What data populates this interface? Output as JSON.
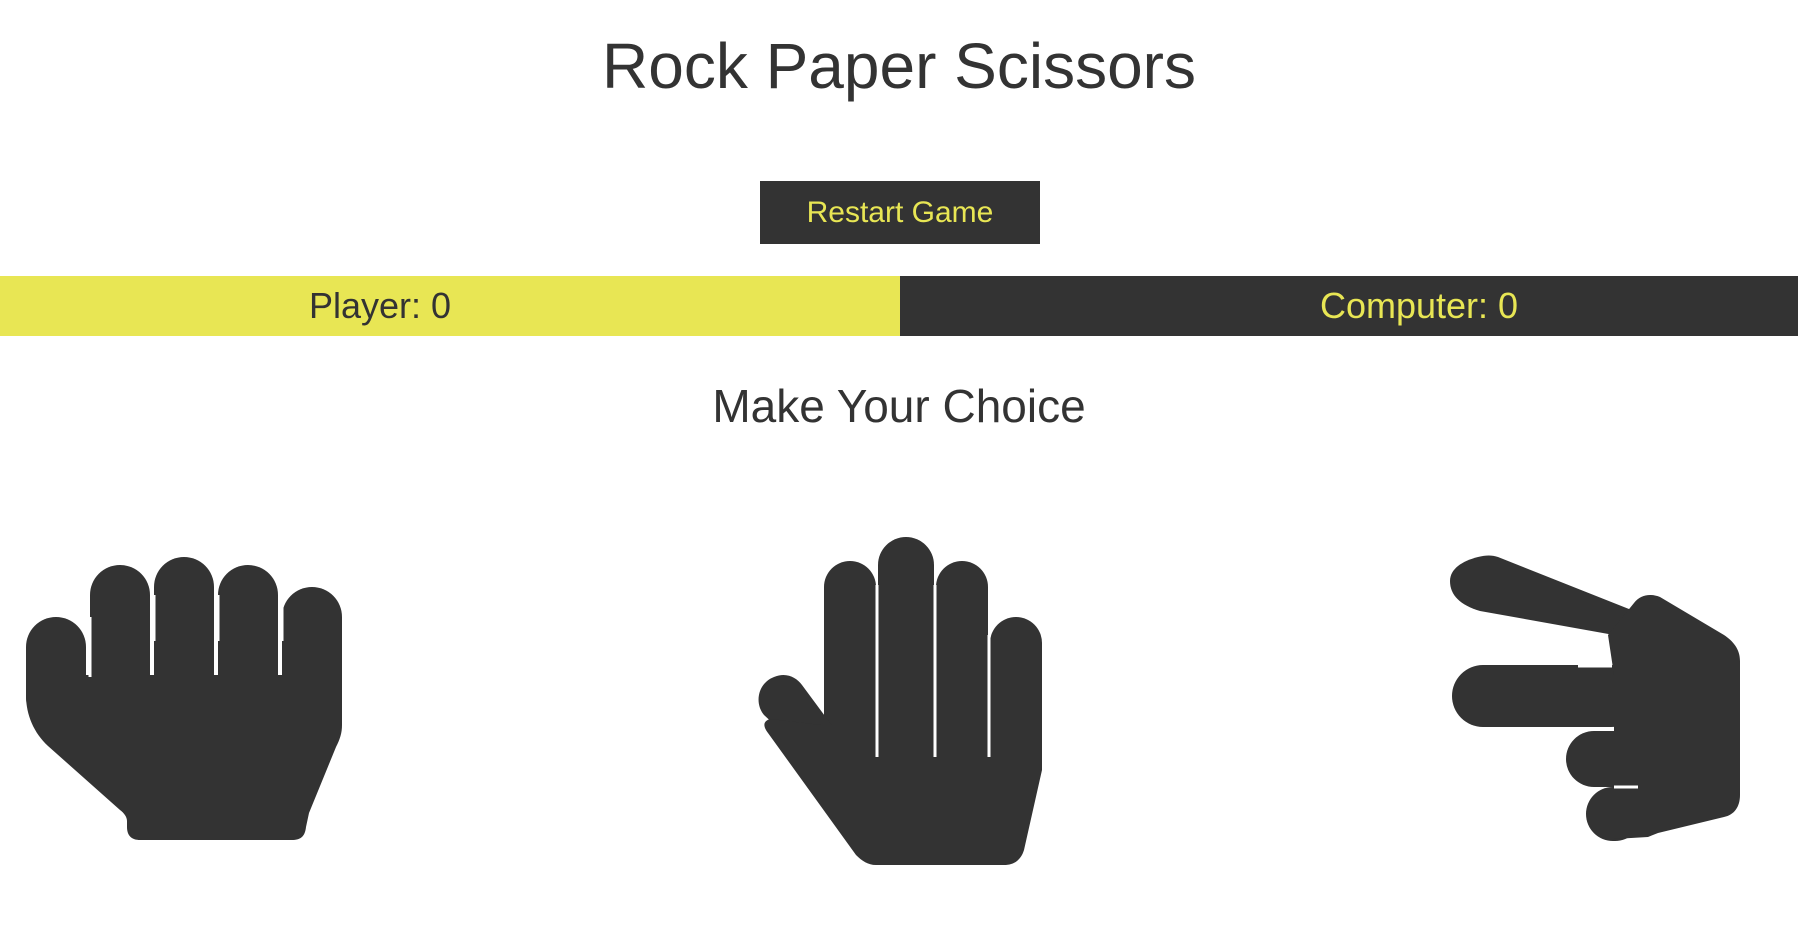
{
  "title": "Rock Paper Scissors",
  "restart": {
    "label": "Restart Game"
  },
  "scoreboard": {
    "player_label": "Player: 0",
    "computer_label": "Computer: 0",
    "player_score": 0,
    "computer_score": 0
  },
  "prompt": "Make Your Choice",
  "choices": [
    {
      "name": "rock",
      "icon": "hand-fist-icon"
    },
    {
      "name": "paper",
      "icon": "hand-open-icon"
    },
    {
      "name": "scissors",
      "icon": "hand-scissors-icon"
    }
  ],
  "colors": {
    "accent": "#e8e654",
    "dark": "#333333",
    "background": "#ffffff"
  }
}
